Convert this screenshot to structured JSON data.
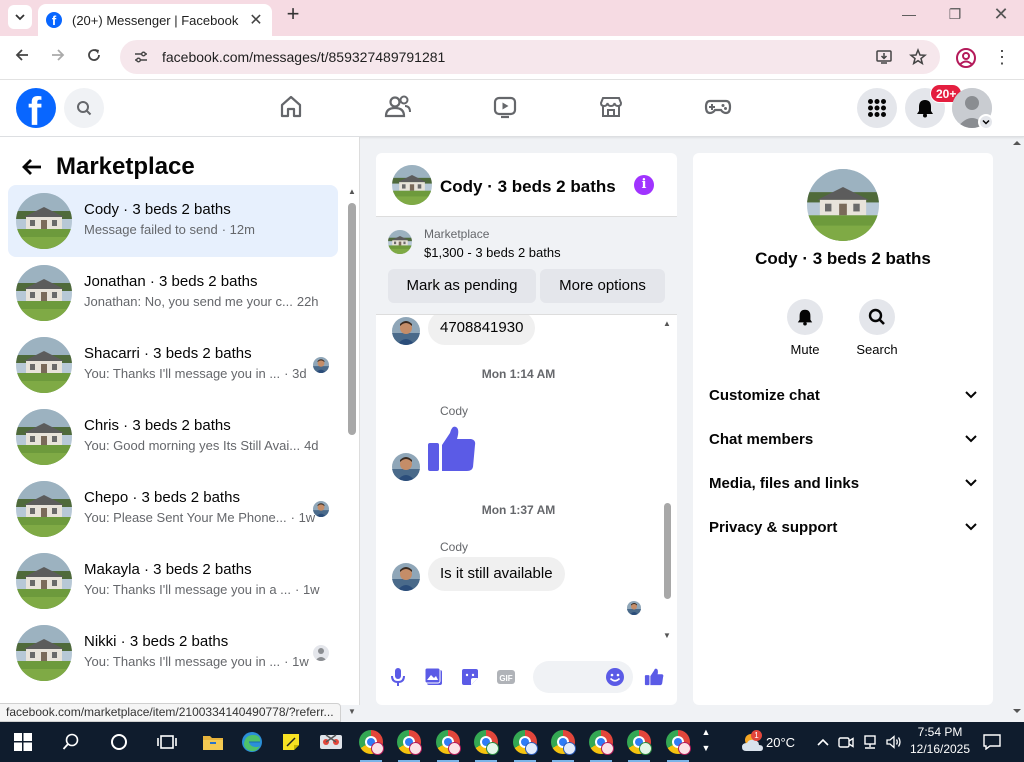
{
  "browser": {
    "tab_title": "(20+) Messenger | Facebook",
    "url": "facebook.com/messages/t/859327489791281",
    "status_url": "facebook.com/marketplace/item/2100334140490778/?referr..."
  },
  "fbnav": {
    "notification_badge": "20+"
  },
  "left_panel": {
    "title": "Marketplace",
    "conversations": [
      {
        "name": "Cody · 3 beds 2 baths",
        "preview": "Message failed to send",
        "time": "· 12m",
        "active": true,
        "read_avatar": "none"
      },
      {
        "name": "Jonathan · 3 beds 2 baths",
        "preview": "Jonathan: No, you send me your c...",
        "time": "22h",
        "active": false,
        "read_avatar": "none"
      },
      {
        "name": "Shacarri · 3 beds 2 baths",
        "preview": "You: Thanks I'll message you in ...",
        "time": "· 3d",
        "active": false,
        "read_avatar": "person"
      },
      {
        "name": "Chris · 3 beds 2 baths",
        "preview": "You: Good morning yes Its Still Avai...",
        "time": "4d",
        "active": false,
        "read_avatar": "none"
      },
      {
        "name": "Chepo · 3 beds 2 baths",
        "preview": "You: Please Sent Your Me Phone...",
        "time": "· 1w",
        "active": false,
        "read_avatar": "person"
      },
      {
        "name": "Makayla · 3 beds 2 baths",
        "preview": "You: Thanks I'll message you in a ...",
        "time": "· 1w",
        "active": false,
        "read_avatar": "none"
      },
      {
        "name": "Nikki · 3 beds 2 baths",
        "preview": "You: Thanks I'll message you in ...",
        "time": "· 1w",
        "active": false,
        "read_avatar": "generic"
      }
    ]
  },
  "chat": {
    "header_name": "Cody · 3 beds 2 baths",
    "marketplace_label": "Marketplace",
    "listing_price": "$1,300 - 3 beds 2 baths",
    "mark_pending_label": "Mark as pending",
    "more_options_label": "More options",
    "messages": {
      "phone_bubble": "4708841930",
      "timestamp_1": "Mon 1:14 AM",
      "sender_1": "Cody",
      "timestamp_2": "Mon 1:37 AM",
      "sender_2": "Cody",
      "bubble_2": "Is it still available"
    }
  },
  "info_panel": {
    "name": "Cody · 3 beds 2 baths",
    "actions": [
      {
        "label": "Mute",
        "icon": "bell-icon"
      },
      {
        "label": "Search",
        "icon": "search-icon"
      }
    ],
    "sections": [
      "Customize chat",
      "Chat members",
      "Media, files and links",
      "Privacy & support"
    ]
  },
  "taskbar": {
    "temperature": "20°C",
    "time": "7:54 PM",
    "date": "12/16/2025",
    "weather_badge": "1"
  },
  "colors": {
    "facebook_blue": "#0866ff",
    "messenger_accent": "#5b5be6",
    "info_purple": "#a033ff",
    "active_row": "#e7f0fd",
    "notif_red": "#e41e3f"
  }
}
